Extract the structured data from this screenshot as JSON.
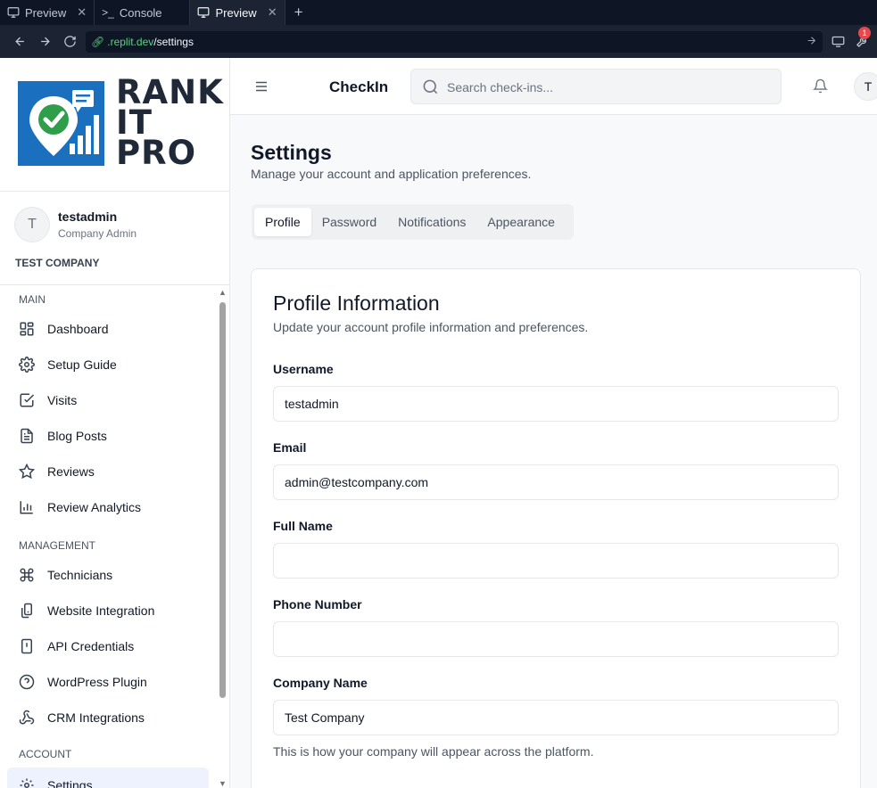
{
  "browser": {
    "tabs": [
      {
        "label": "Preview",
        "icon": "monitor-icon"
      },
      {
        "label": "Console",
        "icon": "terminal-icon"
      },
      {
        "label": "Preview",
        "icon": "monitor-icon"
      }
    ],
    "url_host": ".replit.dev",
    "url_path": "/settings",
    "notification_count": "1"
  },
  "brand": {
    "logo_lines": [
      "RANK",
      "IT",
      "PRO"
    ],
    "logo_color": "#1a6fbf"
  },
  "user": {
    "avatar_initial": "T",
    "name": "testadmin",
    "role": "Company Admin",
    "company": "TEST COMPANY"
  },
  "sidebar": {
    "sections": [
      {
        "title": "MAIN",
        "items": [
          {
            "label": "Dashboard",
            "icon": "dashboard-icon"
          },
          {
            "label": "Setup Guide",
            "icon": "gear-icon"
          },
          {
            "label": "Visits",
            "icon": "checkbox-icon"
          },
          {
            "label": "Blog Posts",
            "icon": "document-icon"
          },
          {
            "label": "Reviews",
            "icon": "star-icon"
          },
          {
            "label": "Review Analytics",
            "icon": "bar-chart-icon"
          }
        ]
      },
      {
        "title": "MANAGEMENT",
        "items": [
          {
            "label": "Technicians",
            "icon": "command-icon"
          },
          {
            "label": "Website Integration",
            "icon": "devices-icon"
          },
          {
            "label": "API Credentials",
            "icon": "alert-file-icon"
          },
          {
            "label": "WordPress Plugin",
            "icon": "help-circle-icon"
          },
          {
            "label": "CRM Integrations",
            "icon": "webhook-icon"
          }
        ]
      },
      {
        "title": "ACCOUNT",
        "items": [
          {
            "label": "Settings",
            "icon": "gear-icon",
            "active": true
          }
        ]
      }
    ]
  },
  "header": {
    "app_name": "CheckIn",
    "search_placeholder": "Search check-ins...",
    "avatar_initial": "T"
  },
  "page": {
    "title": "Settings",
    "subtitle": "Manage your account and application preferences.",
    "tabs": [
      "Profile",
      "Password",
      "Notifications",
      "Appearance"
    ],
    "active_tab": "Profile"
  },
  "profile_card": {
    "title": "Profile Information",
    "subtitle": "Update your account profile information and preferences.",
    "fields": {
      "username": {
        "label": "Username",
        "value": "testadmin"
      },
      "email": {
        "label": "Email",
        "value": "admin@testcompany.com"
      },
      "full_name": {
        "label": "Full Name",
        "value": ""
      },
      "phone": {
        "label": "Phone Number",
        "value": ""
      },
      "company": {
        "label": "Company Name",
        "value": "Test Company",
        "help": "This is how your company will appear across the platform."
      }
    }
  }
}
